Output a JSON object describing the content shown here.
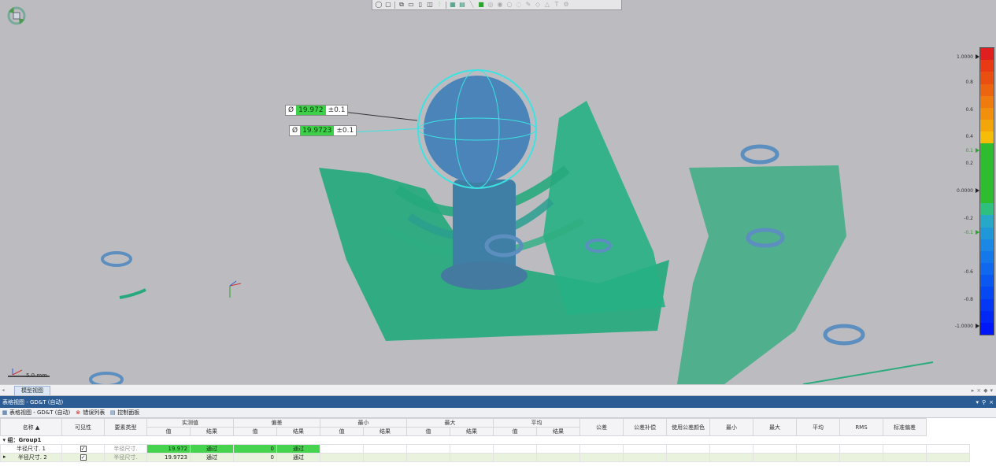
{
  "toolbar": {
    "icons": [
      "select-icon",
      "cube-view-icon",
      "copy-icon",
      "front-view-icon",
      "side-view-icon",
      "split-view-icon",
      "align-icon",
      "grid-icon",
      "table-icon",
      "line-icon",
      "color-square-icon",
      "circle-icon",
      "circle-icon",
      "circle-icon",
      "cylinder-icon",
      "brush-icon",
      "plane-icon",
      "cone-icon",
      "text-icon",
      "settings-icon"
    ]
  },
  "callouts": [
    {
      "symbol": "Ø",
      "value": "19.972",
      "tolerance": "±0.1"
    },
    {
      "symbol": "Ø",
      "value": "19.9723",
      "tolerance": "±0.1"
    }
  ],
  "scale": {
    "label": "5.0 mm"
  },
  "legend": {
    "labels": [
      "1.0000",
      "0.8",
      "0.6",
      "0.4",
      "0.1",
      "0.2",
      "0.0000",
      "-0.2",
      "-0.1",
      "-0.6",
      "-0.8",
      "-1.0000"
    ],
    "colors": [
      "#e02020",
      "#e83a14",
      "#ea4f12",
      "#ec6410",
      "#ef7a0e",
      "#f0900c",
      "#f2a60a",
      "#f5bd08",
      "#2fbd2f",
      "#2fbd2f",
      "#2fbd2f",
      "#2fbd2f",
      "#2fbd2f",
      "#2fc080",
      "#27a8c8",
      "#2098d8",
      "#1a88e4",
      "#1478ea",
      "#0f68ee",
      "#0a58f0",
      "#0648f2",
      "#0438f4",
      "#0228f6",
      "#0018f8"
    ]
  },
  "view_tabs": {
    "active": "模型视图"
  },
  "panel": {
    "title": "表格视图 - GD&T (自动)",
    "tabs": [
      "表格视图 - GD&T (自动)",
      "错误列表",
      "控制面板"
    ]
  },
  "table": {
    "headers_top": [
      "名称",
      "可见性",
      "要素类型",
      "实测值",
      "偏差",
      "最小",
      "最大",
      "平均",
      "公差",
      "公差补偿",
      "使用公差颜色",
      "最小",
      "最大",
      "平均",
      "RMS",
      "标准偏差"
    ],
    "sub_value": "值",
    "sub_result": "结果",
    "group_label": "组：Group1",
    "rows": [
      {
        "name": "半径尺寸. 1",
        "type": "半径尺寸.",
        "value": "19.972",
        "result": "通过",
        "dev": "0",
        "dev_result": "通过"
      },
      {
        "name": "半径尺寸. 2",
        "type": "半径尺寸.",
        "value": "19.9723",
        "result": "通过",
        "dev": "0",
        "dev_result": "通过"
      }
    ]
  }
}
